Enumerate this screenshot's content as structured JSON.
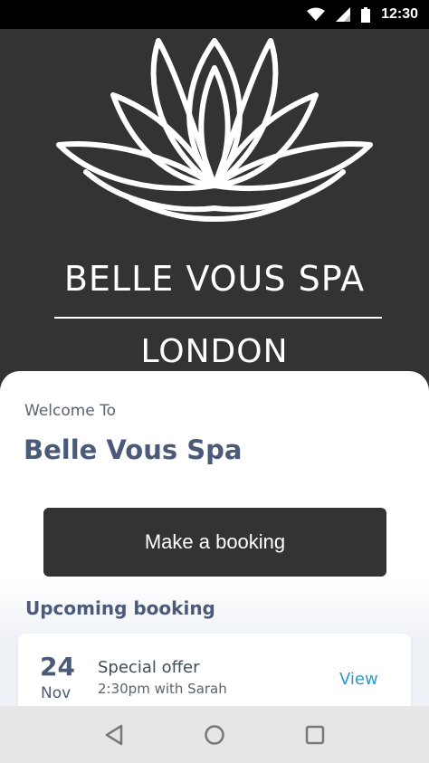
{
  "status_bar": {
    "time": "12:30",
    "icons": [
      "wifi-icon",
      "signal-icon",
      "battery-icon"
    ]
  },
  "header": {
    "logo_icon": "lotus-icon",
    "brand_name": "BELLE VOUS SPA",
    "city": "LONDON"
  },
  "welcome": {
    "subtitle": "Welcome To",
    "title": "Belle Vous Spa"
  },
  "booking_button": {
    "label": "Make a booking"
  },
  "upcoming": {
    "title": "Upcoming booking",
    "items": [
      {
        "day": "24",
        "month": "Nov",
        "title": "Special offer",
        "details": "2:30pm with Sarah",
        "action": "View"
      }
    ]
  },
  "nav_bar": {
    "buttons": [
      "back-icon",
      "home-icon",
      "recents-icon"
    ]
  },
  "colors": {
    "dark": "#333333",
    "heading": "#4a5a78",
    "link": "#2a9bc9"
  }
}
